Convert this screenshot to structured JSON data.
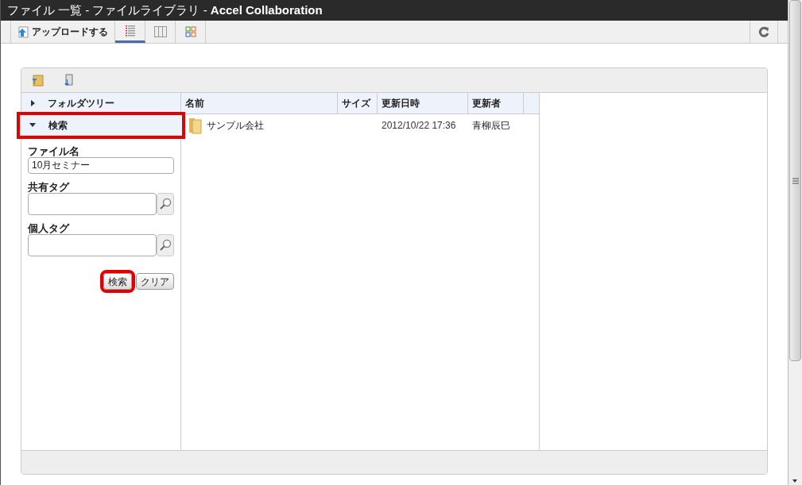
{
  "window": {
    "title": "ファイル 一覧 - ファイルライブラリ - ",
    "title_bold": "Accel Collaboration"
  },
  "toolbar": {
    "upload": "アップロードする",
    "views": [
      {
        "kind": "list",
        "selected": true
      },
      {
        "kind": "columns",
        "selected": false
      },
      {
        "kind": "tiles",
        "selected": false
      }
    ]
  },
  "sidebar": {
    "sections": [
      {
        "label": "フォルダツリー",
        "expanded": false,
        "highlighted": false
      },
      {
        "label": "検索",
        "expanded": true,
        "highlighted": true
      }
    ],
    "fields": [
      {
        "label": "ファイル名",
        "value": "10月セミナー",
        "kind": "text"
      },
      {
        "label": "共有タグ",
        "kind": "tag"
      },
      {
        "label": "個人タグ",
        "kind": "tag"
      }
    ],
    "buttons": [
      {
        "label": "検索",
        "highlighted": true
      },
      {
        "label": "クリア",
        "highlighted": false
      }
    ]
  },
  "table": {
    "columns": [
      "名前",
      "サイズ",
      "更新日時",
      "更新者"
    ],
    "rows": [
      {
        "kind": "folder",
        "name": "サンプル会社",
        "date": "2012/10/22 17:36",
        "updater": "青柳辰巳"
      }
    ]
  }
}
